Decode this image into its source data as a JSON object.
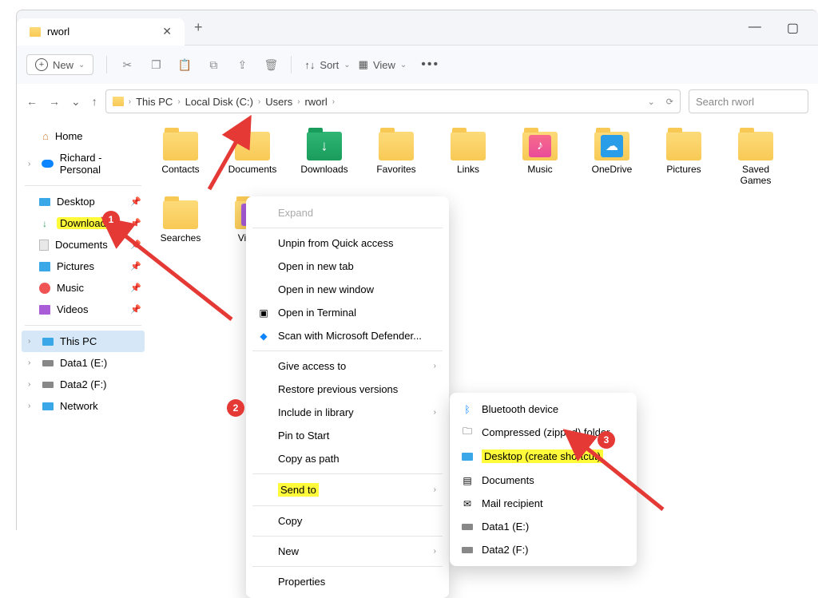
{
  "titlebar": {
    "tab_title": "rworl"
  },
  "toolbar": {
    "new": "New",
    "sort": "Sort",
    "view": "View"
  },
  "breadcrumb": {
    "thispc": "This PC",
    "disk": "Local Disk (C:)",
    "users": "Users",
    "user": "rworl"
  },
  "search": {
    "placeholder": "Search rworl"
  },
  "sidebar": {
    "home": "Home",
    "personal": "Richard - Personal",
    "desktop": "Desktop",
    "downloads": "Downloads",
    "documents": "Documents",
    "pictures": "Pictures",
    "music": "Music",
    "videos": "Videos",
    "thispc": "This PC",
    "data1": "Data1 (E:)",
    "data2": "Data2 (F:)",
    "network": "Network"
  },
  "folders": {
    "contacts": "Contacts",
    "documents": "Documents",
    "downloads": "Downloads",
    "favorites": "Favorites",
    "links": "Links",
    "music": "Music",
    "onedrive": "OneDrive",
    "pictures": "Pictures",
    "savedgames": "Saved Games",
    "searches": "Searches",
    "videos": "Videos"
  },
  "ctx": {
    "expand": "Expand",
    "unpin": "Unpin from Quick access",
    "newtab": "Open in new tab",
    "newwin": "Open in new window",
    "terminal": "Open in Terminal",
    "defender": "Scan with Microsoft Defender...",
    "access": "Give access to",
    "restore": "Restore previous versions",
    "library": "Include in library",
    "pinstart": "Pin to Start",
    "copypath": "Copy as path",
    "sendto": "Send to",
    "copy": "Copy",
    "new": "New",
    "properties": "Properties"
  },
  "sendto": {
    "bluetooth": "Bluetooth device",
    "compressed": "Compressed (zipped) folder",
    "desktop": "Desktop (create shortcut)",
    "documents": "Documents",
    "mail": "Mail recipient",
    "data1": "Data1 (E:)",
    "data2": "Data2 (F:)"
  },
  "annotations": {
    "b1": "1",
    "b2": "2",
    "b3": "3"
  }
}
